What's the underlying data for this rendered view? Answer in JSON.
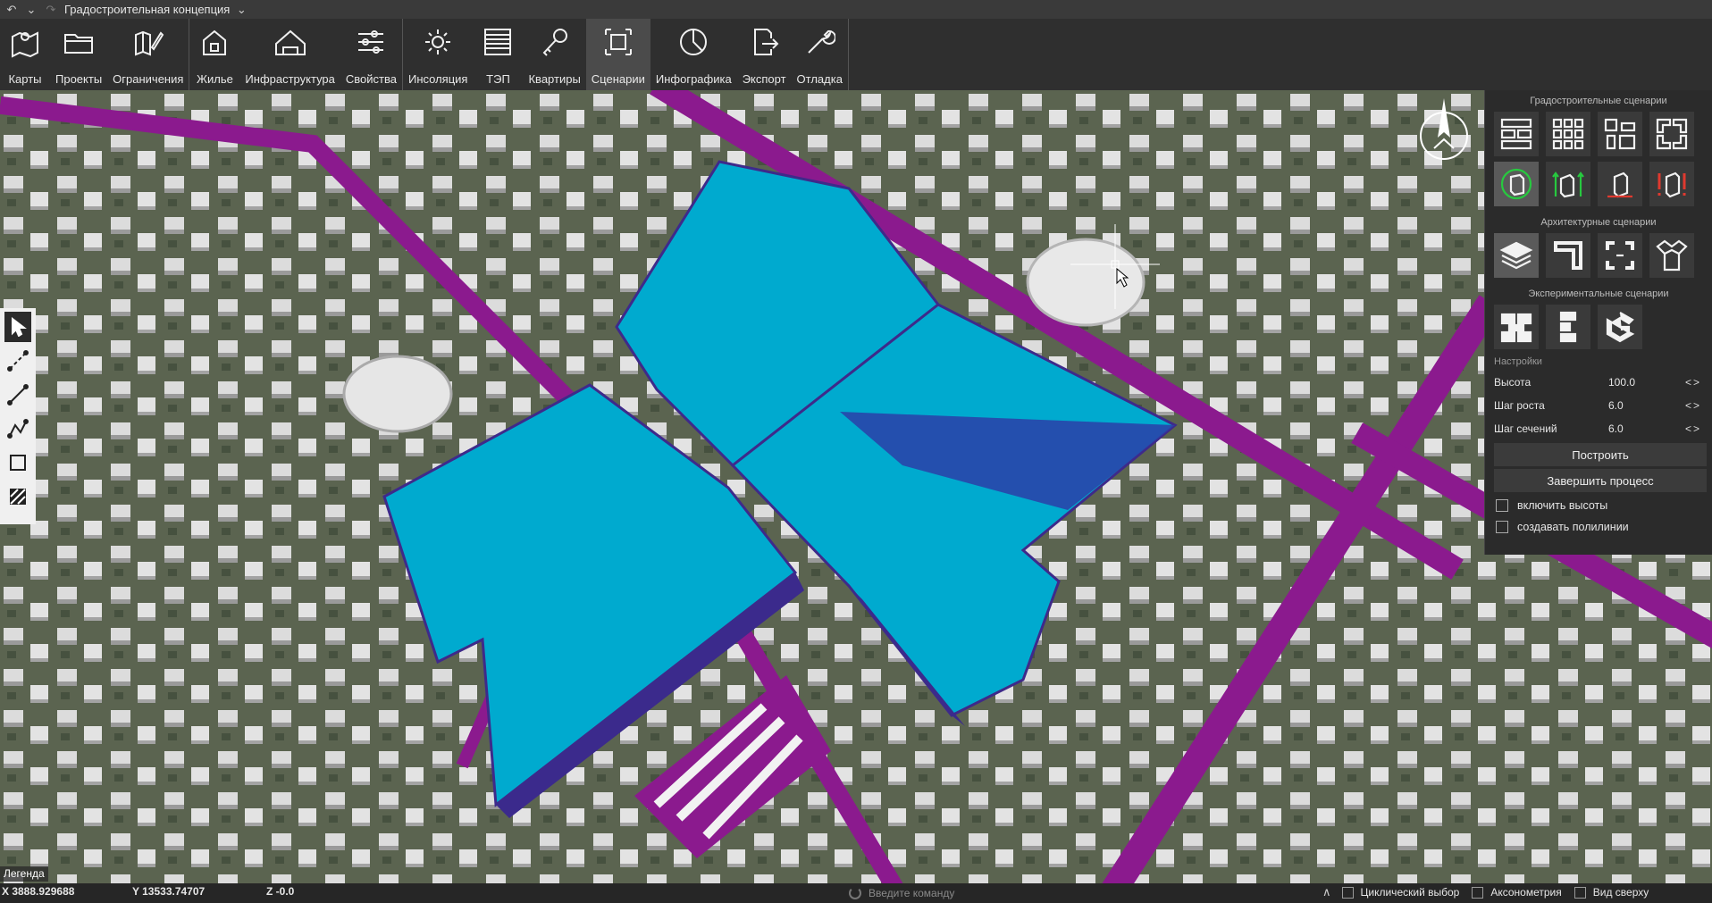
{
  "titlebar": {
    "undo_icon": "undo-icon",
    "dropdown_icon": "chevron-down-icon",
    "redo_icon": "redo-icon",
    "title": "Градостроительная концепция"
  },
  "ribbon": {
    "groups": [
      [
        {
          "label": "Карты",
          "icon": "map-pin-icon"
        },
        {
          "label": "Проекты",
          "icon": "folder-icon"
        },
        {
          "label": "Ограничения",
          "icon": "map-edit-icon"
        }
      ],
      [
        {
          "label": "Жилье",
          "icon": "house-icon"
        },
        {
          "label": "Инфраструктура",
          "icon": "building-icon"
        },
        {
          "label": "Свойства",
          "icon": "sliders-icon"
        }
      ],
      [
        {
          "label": "Инсоляция",
          "icon": "sun-icon"
        },
        {
          "label": "ТЭП",
          "icon": "table-icon"
        },
        {
          "label": "Квартиры",
          "icon": "key-icon"
        },
        {
          "label": "Сценарии",
          "icon": "scenario-frame-icon",
          "active": true
        },
        {
          "label": "Инфографика",
          "icon": "pie-chart-icon"
        },
        {
          "label": "Экспорт",
          "icon": "export-icon"
        },
        {
          "label": "Отладка",
          "icon": "wrench-icon"
        }
      ]
    ]
  },
  "left_tools": [
    "pointer-arrow-icon",
    "dashed-line-icon",
    "line-icon",
    "polyline-icon",
    "rectangle-icon",
    "hatch-icon"
  ],
  "panel": {
    "urban_title": "Градостроительные сценарии",
    "arch_title": "Архитектурные сценарии",
    "exp_title": "Экспериментальные сценарии",
    "settings_title": "Настройки",
    "rows": [
      {
        "label": "Высота",
        "value": "100.0"
      },
      {
        "label": "Шаг роста",
        "value": "6.0"
      },
      {
        "label": "Шаг сечений",
        "value": "6.0"
      }
    ],
    "build_label": "Построить",
    "finish_label": "Завершить процесс",
    "check_heights": "включить высоты",
    "check_polylines": "создавать полилинии"
  },
  "legend": "Легенда",
  "status": {
    "x": "X 3888.929688",
    "y": "Y 13533.74707",
    "z": "Z -0.0",
    "cmd_placeholder": "Введите команду",
    "opt_cyclic": "Циклический выбор",
    "opt_axon": "Аксонометрия",
    "opt_top": "Вид сверху"
  },
  "colors": {
    "volume": "#00b4d8",
    "buffer": "#8b1a8e",
    "panel_bg": "#2b2b2b"
  }
}
